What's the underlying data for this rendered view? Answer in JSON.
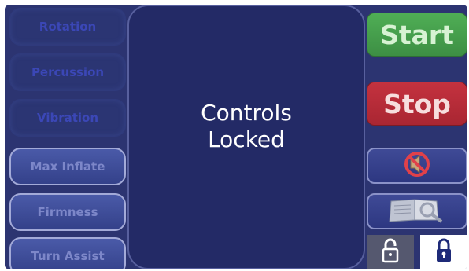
{
  "left_menu": {
    "items": [
      {
        "label": "Rotation"
      },
      {
        "label": "Percussion"
      },
      {
        "label": "Vibration"
      },
      {
        "label": "Max Inflate"
      },
      {
        "label": "Firmness"
      },
      {
        "label": "Turn Assist"
      }
    ]
  },
  "center": {
    "line1": "Controls",
    "line2": "Locked"
  },
  "right_panel": {
    "start_label": "Start",
    "stop_label": "Stop",
    "mute_icon": "no-sound-icon",
    "manual_icon": "manual-search-icon"
  },
  "lock": {
    "unlock_icon": "unlock-icon",
    "lock_icon": "lock-icon",
    "state": "locked"
  },
  "colors": {
    "background": "#2c3471",
    "center_panel": "#232a66",
    "start": "#46a04d",
    "stop": "#b82c38"
  }
}
